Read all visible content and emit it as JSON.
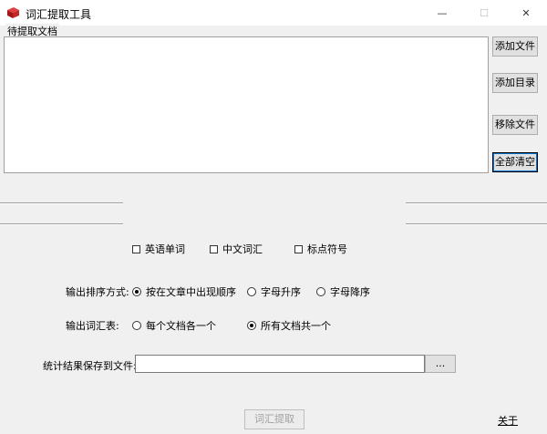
{
  "window": {
    "title": "词汇提取工具",
    "minimize_glyph": "—",
    "maximize_glyph": "☐",
    "close_glyph": "✕"
  },
  "file_group": {
    "label": "待提取文档",
    "buttons": {
      "add_file": "添加文件",
      "add_dir": "添加目录",
      "remove_file": "移除文件",
      "clear_all": "全部清空"
    }
  },
  "options": {
    "types": [
      {
        "label": "英语单词",
        "checked": false
      },
      {
        "label": "中文词汇",
        "checked": false
      },
      {
        "label": "标点符号",
        "checked": false
      }
    ],
    "sort_label": "输出排序方式:",
    "sort_options": [
      {
        "label": "按在文章中出现顺序",
        "selected": true
      },
      {
        "label": "字母升序",
        "selected": false
      },
      {
        "label": "字母降序",
        "selected": false
      }
    ],
    "output_label": "输出词汇表:",
    "output_options": [
      {
        "label": "每个文档各一个",
        "selected": false
      },
      {
        "label": "所有文档共一个",
        "selected": true
      }
    ],
    "save_label": "统计结果保存到文件:",
    "save_value": "",
    "browse_label": "..."
  },
  "actions": {
    "extract_label": "词汇提取",
    "about_label": "关于"
  },
  "colors": {
    "background": "#f0f0f0",
    "accent": "#0078d7"
  }
}
